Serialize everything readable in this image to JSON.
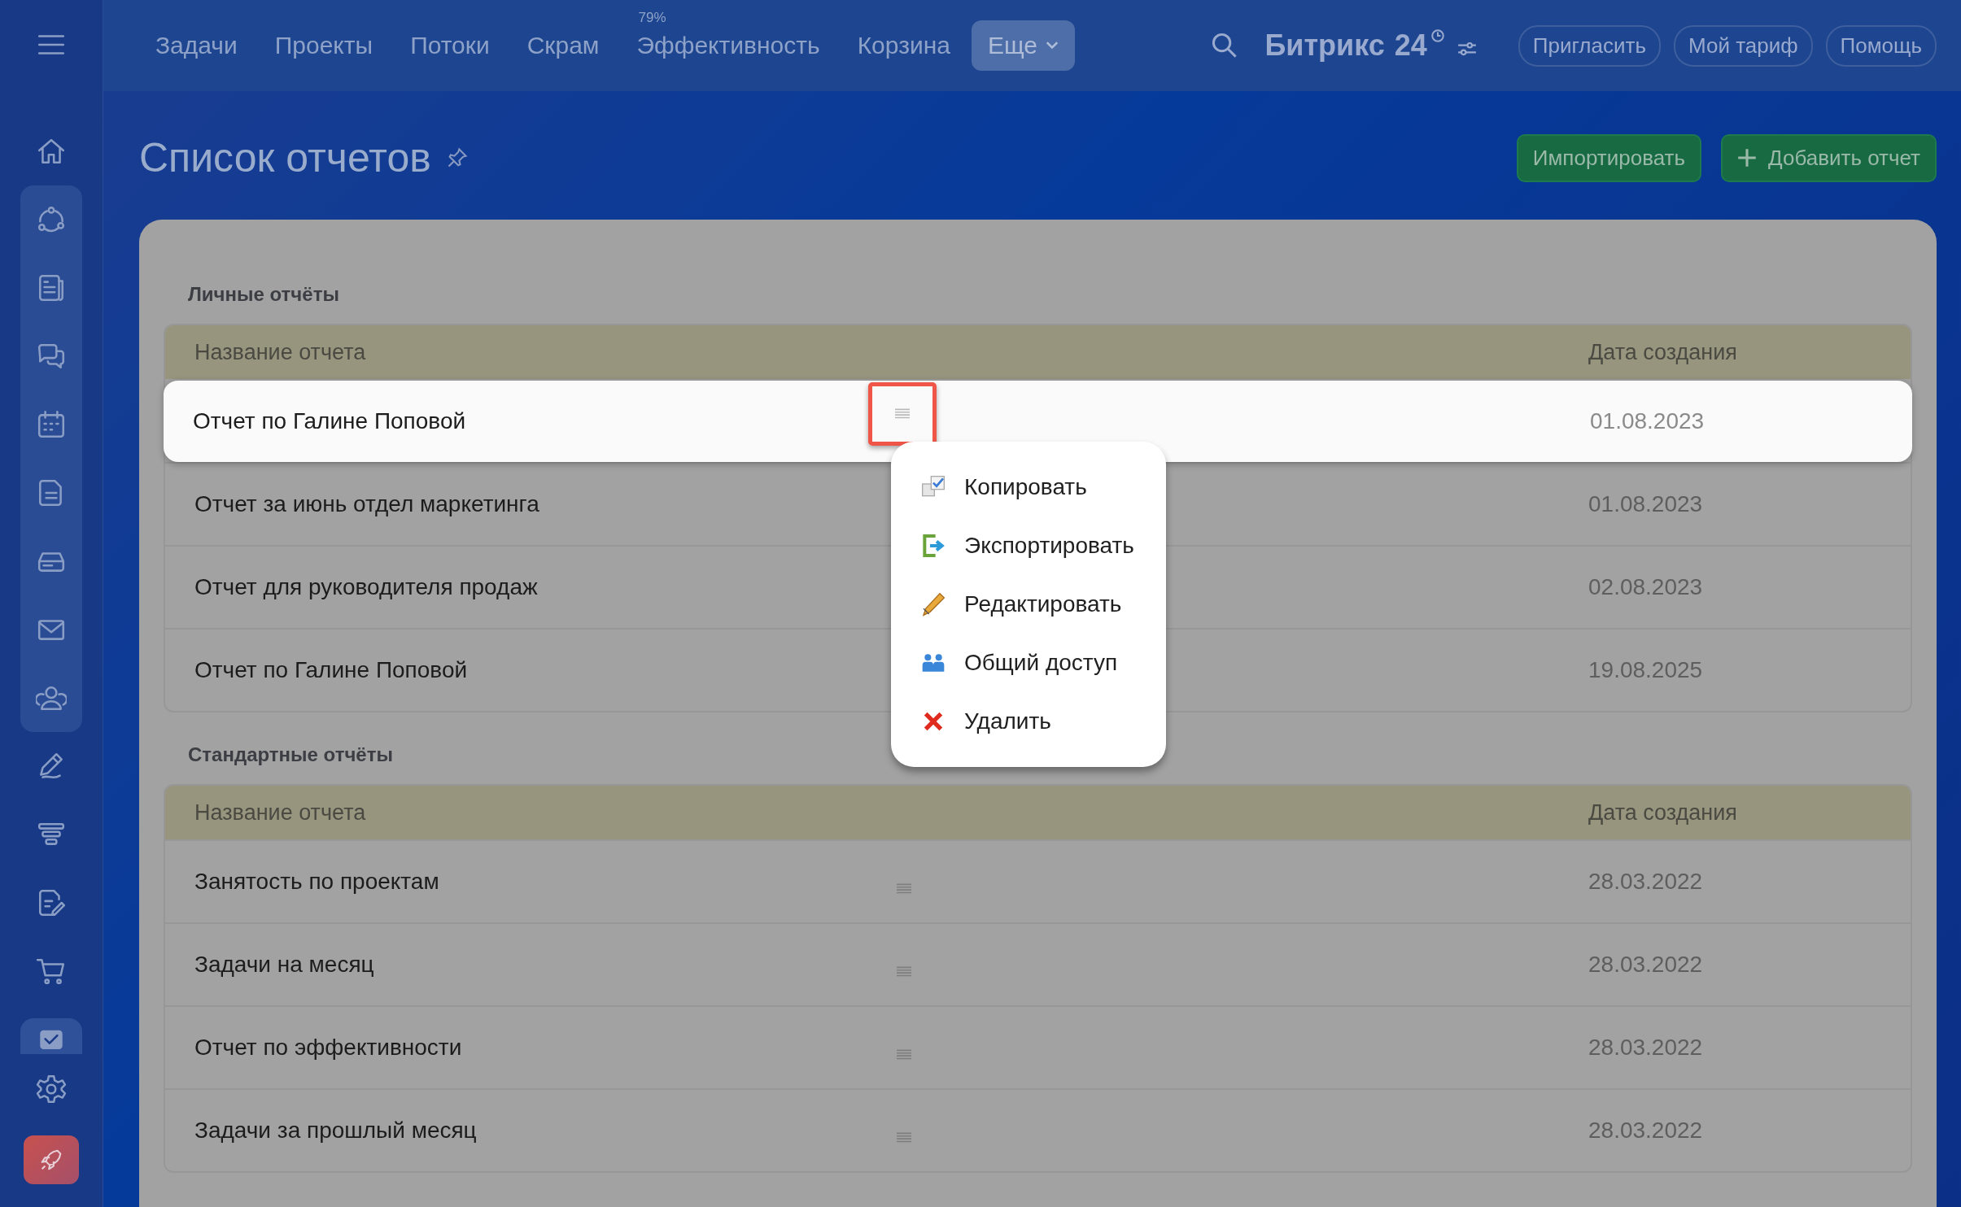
{
  "top_nav": [
    {
      "label": "Задачи",
      "selected": false
    },
    {
      "label": "Проекты",
      "selected": false
    },
    {
      "label": "Потоки",
      "selected": false
    },
    {
      "label": "Скрам",
      "selected": false
    },
    {
      "label": "Эффективность",
      "badge": "79%",
      "selected": false
    },
    {
      "label": "Корзина",
      "selected": false
    },
    {
      "label": "Еще",
      "selected": true
    }
  ],
  "brand": {
    "name": "Битрикс",
    "number": "24"
  },
  "header_buttons": [
    "Пригласить",
    "Мой тариф",
    "Помощь"
  ],
  "page": {
    "title": "Список отчетов",
    "buttons": [
      {
        "label": "Импортировать",
        "kind": "plain"
      },
      {
        "label": "Добавить отчет",
        "kind": "add"
      }
    ]
  },
  "sections": [
    {
      "title": "Личные отчёты",
      "columns": [
        "Название отчета",
        "Дата создания"
      ],
      "rows": [
        {
          "name": "Отчет по Галине Поповой",
          "date": "01.08.2023",
          "selected": true
        },
        {
          "name": "Отчет за июнь отдел маркетинга",
          "date": "01.08.2023",
          "selected": false
        },
        {
          "name": "Отчет для руководителя продаж",
          "date": "02.08.2023",
          "selected": false
        },
        {
          "name": "Отчет по Галине Поповой",
          "date": "19.08.2025",
          "selected": false
        }
      ]
    },
    {
      "title": "Стандартные отчёты",
      "columns": [
        "Название отчета",
        "Дата создания"
      ],
      "rows": [
        {
          "name": "Занятость по проектам",
          "date": "28.03.2022",
          "selected": false
        },
        {
          "name": "Задачи на месяц",
          "date": "28.03.2022",
          "selected": false
        },
        {
          "name": "Отчет по эффективности",
          "date": "28.03.2022",
          "selected": false
        },
        {
          "name": "Задачи за прошлый месяц",
          "date": "28.03.2022",
          "selected": false
        }
      ]
    }
  ],
  "context_menu": [
    {
      "label": "Копировать",
      "kind": "copy"
    },
    {
      "label": "Экспортировать",
      "kind": "export"
    },
    {
      "label": "Редактировать",
      "kind": "edit"
    },
    {
      "label": "Общий доступ",
      "kind": "share"
    },
    {
      "label": "Удалить",
      "kind": "delete"
    }
  ]
}
